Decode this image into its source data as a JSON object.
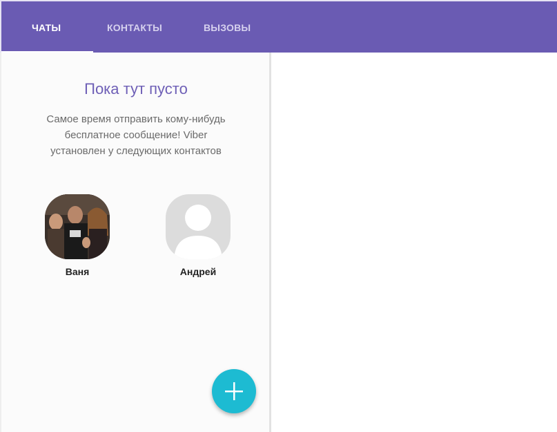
{
  "tabs": [
    {
      "label": "ЧАТЫ",
      "active": true
    },
    {
      "label": "КОНТАКТЫ",
      "active": false
    },
    {
      "label": "ВЫЗОВЫ",
      "active": false
    }
  ],
  "empty_state": {
    "title": "Пока тут пусто",
    "message": "Самое время отправить кому-нибудь бесплатное сообщение! Viber установлен у следующих контактов"
  },
  "contacts": [
    {
      "name": "Ваня",
      "avatar": "photo"
    },
    {
      "name": "Андрей",
      "avatar": "default-avatar-icon"
    }
  ],
  "fab": {
    "icon": "plus-icon"
  },
  "colors": {
    "header": "#6a5bb3",
    "title_accent": "#6e5fb6",
    "fab": "#1dbbd2"
  }
}
